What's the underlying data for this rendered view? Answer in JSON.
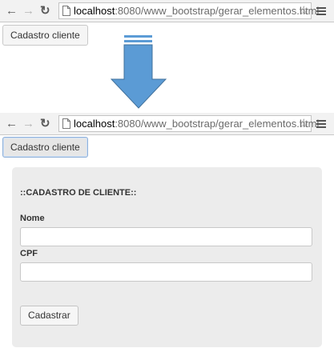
{
  "browser": {
    "url_host": "localhost",
    "url_rest": ":8080/www_bootstrap/gerar_elementos.html",
    "icons": [
      "back-arrow-icon",
      "forward-arrow-icon",
      "reload-icon",
      "page-icon",
      "star-icon",
      "menu-icon"
    ]
  },
  "before": {
    "button_label": "Cadastro cliente"
  },
  "transition": {
    "arrow_icon": "down-arrow-icon",
    "arrow_color": "#5b9bd5"
  },
  "after": {
    "button_label": "Cadastro cliente",
    "form": {
      "title": "::CADASTRO DE CLIENTE::",
      "nome_label": "Nome",
      "nome_value": "",
      "cpf_label": "CPF",
      "cpf_value": "",
      "submit_label": "Cadastrar"
    }
  },
  "colors": {
    "panel_bg": "#ececec",
    "focus_border": "#8fb0d8"
  }
}
